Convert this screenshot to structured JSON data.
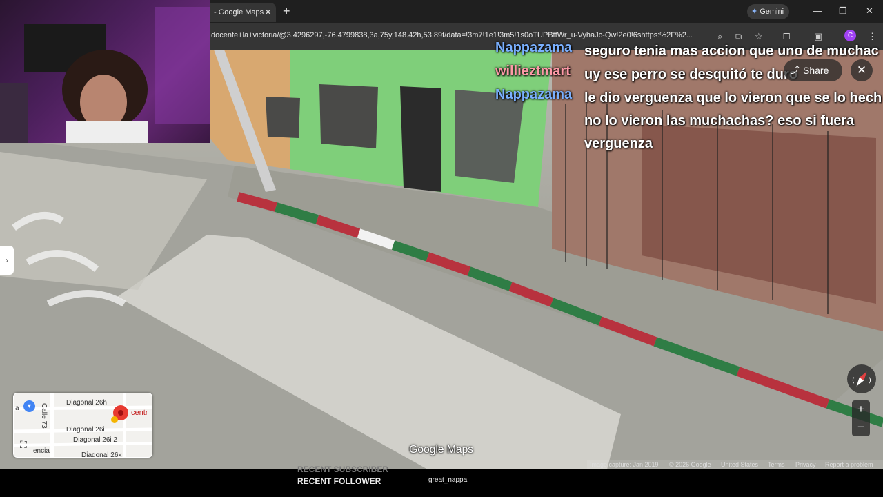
{
  "browser": {
    "tab_title": "- Google Maps",
    "tab_close": "✕",
    "new_tab": "+",
    "gemini_label": "Gemini",
    "url": "docente+la+victoria/@3.4296297,-76.4799838,3a,75y,148.42h,53.89t/data=!3m7!1e1!3m5!1s0oTUPBtfWr_u-VyhaJc-Qw!2e0!6shttps:%2F%2...",
    "profile_initial": "C",
    "minimize": "—",
    "maximize": "❐",
    "close": "✕"
  },
  "chat": [
    {
      "user": "Nappazama",
      "color": "#7ab0ff",
      "message": "seguro tenia mas accion que uno de muchac"
    },
    {
      "user": "willieztmart",
      "color": "#ff9aa8",
      "message": "uy ese perro se desquitó te duro"
    },
    {
      "user": "Nappazama",
      "color": "#7ab0ff",
      "message": "le dio verguenza que lo vieron que se lo hech no lo vieron las muchachas? eso si fuera verguenza"
    }
  ],
  "maps": {
    "share_label": "Share",
    "close_label": "✕",
    "side_arrow": "›",
    "zoom_in": "+",
    "zoom_out": "−",
    "logo": "Google Maps",
    "minimap_labels": {
      "street1": "Diagonal 26h",
      "street2": "Diagonal 26i",
      "street3": "Diagonal 26i 2",
      "street4": "Diagonal 26k",
      "calle": "Calle 73",
      "centr": "centr",
      "left_text": "a",
      "bottom_left": "encia"
    },
    "attribution": {
      "capture": "Image capture: Jan 2019",
      "copyright": "© 2026 Google",
      "region": "United States",
      "terms": "Terms",
      "privacy": "Privacy",
      "report": "Report a problem"
    }
  },
  "stream_overlay": {
    "recent_subscriber_label": "RECENT SUBSCRIBER",
    "recent_follower_label": "RECENT FOLLOWER",
    "recent_follower_value": "great_nappa"
  },
  "colors": {
    "chrome_dark": "#1f1f1f",
    "addr_bar": "#353535",
    "wall_green": "#7fcf7a",
    "curb_red": "#b8323e",
    "curb_green": "#2f7d45"
  }
}
